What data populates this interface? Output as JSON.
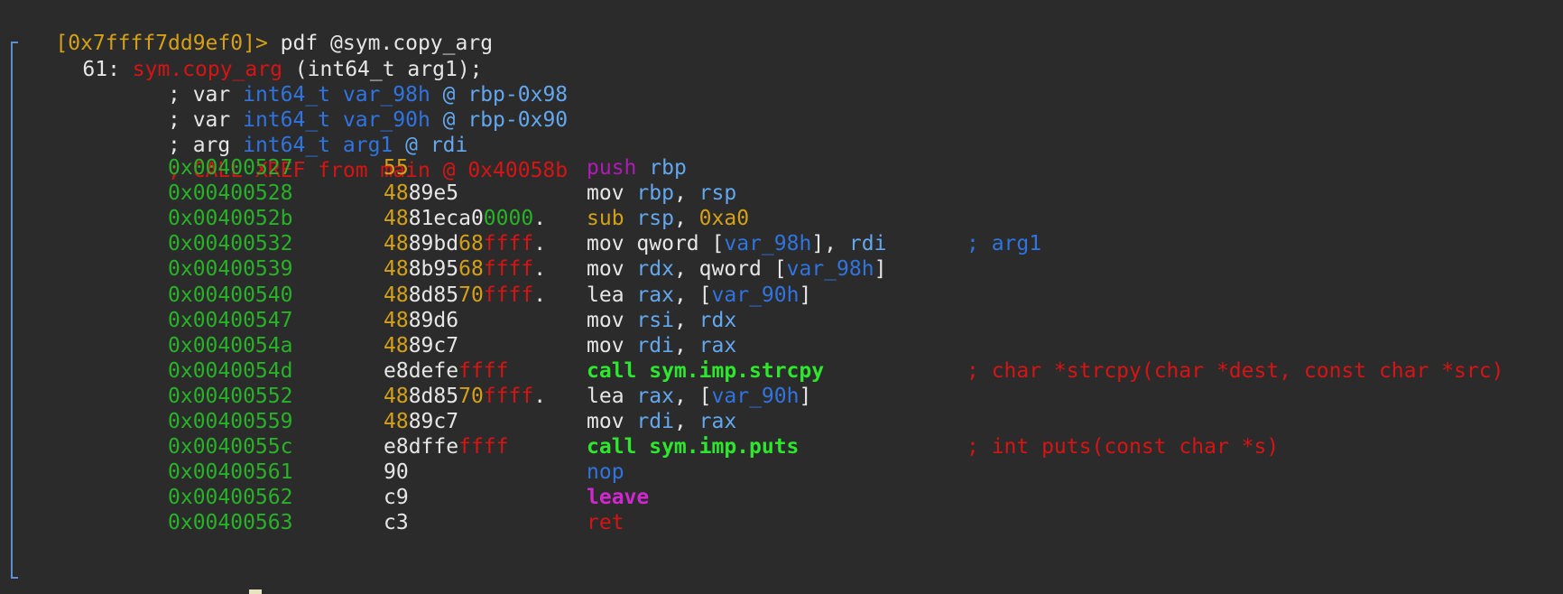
{
  "colors": {
    "background": "#2b2b2b",
    "default_text": "#e6e6e6",
    "prompt": "#d4a017",
    "address": "#27b227",
    "symbol_red": "#d71414",
    "type_blue": "#2f74e0",
    "register_blue": "#63a8ef",
    "byte_yellow": "#d4a017",
    "push_magenta": "#b21ab8",
    "call_green": "#2ee62e",
    "leave_magenta": "#d028d0",
    "nop_blue": "#2f74e0",
    "gutter_line": "#5a8fd0"
  },
  "prompt": {
    "address": "[0x7ffff7dd9ef0]>",
    "command": " pdf @sym.copy_arg"
  },
  "function_header": {
    "size_prefix": "61: ",
    "name": "sym.copy_arg",
    "signature": " (int64_t arg1);"
  },
  "vars": [
    {
      "prefix": "; var ",
      "type": "int64_t",
      "name": " var_98h",
      "at": " @ ",
      "loc": "rbp-0x98"
    },
    {
      "prefix": "; var ",
      "type": "int64_t",
      "name": " var_90h",
      "at": " @ ",
      "loc": "rbp-0x90"
    },
    {
      "prefix": "; arg ",
      "type": "int64_t",
      "name": " arg1",
      "at": " @ ",
      "loc": "rdi"
    }
  ],
  "xref_comment": "; CALL XREF from main @ 0x40058b",
  "instructions": [
    {
      "addr": "0x00400527",
      "bytes": "55",
      "mnemonic": "push",
      "operands": " rbp",
      "comment": ""
    },
    {
      "addr": "0x00400528",
      "bytes": "4889e5",
      "mnemonic": "mov",
      "operands": " rbp, rsp",
      "comment": ""
    },
    {
      "addr": "0x0040052b",
      "bytes": "4881eca00000.",
      "mnemonic": "sub",
      "operands": " rsp, 0xa0",
      "comment": ""
    },
    {
      "addr": "0x00400532",
      "bytes": "4889bd68ffff.",
      "mnemonic": "mov",
      "operands": " qword [var_98h], rdi",
      "comment": "; arg1"
    },
    {
      "addr": "0x00400539",
      "bytes": "488b9568ffff.",
      "mnemonic": "mov",
      "operands": " rdx, qword [var_98h]",
      "comment": ""
    },
    {
      "addr": "0x00400540",
      "bytes": "488d8570ffff.",
      "mnemonic": "lea",
      "operands": " rax, [var_90h]",
      "comment": ""
    },
    {
      "addr": "0x00400547",
      "bytes": "4889d6",
      "mnemonic": "mov",
      "operands": " rsi, rdx",
      "comment": ""
    },
    {
      "addr": "0x0040054a",
      "bytes": "4889c7",
      "mnemonic": "mov",
      "operands": " rdi, rax",
      "comment": ""
    },
    {
      "addr": "0x0040054d",
      "bytes": "e8defeffff",
      "mnemonic": "call",
      "operands": " sym.imp.strcpy",
      "comment": "; char *strcpy(char *dest, const char *src)"
    },
    {
      "addr": "0x00400552",
      "bytes": "488d8570ffff.",
      "mnemonic": "lea",
      "operands": " rax, [var_90h]",
      "comment": ""
    },
    {
      "addr": "0x00400559",
      "bytes": "4889c7",
      "mnemonic": "mov",
      "operands": " rdi, rax",
      "comment": ""
    },
    {
      "addr": "0x0040055c",
      "bytes": "e8dffeffff",
      "mnemonic": "call",
      "operands": " sym.imp.puts",
      "comment": "; int puts(const char *s)"
    },
    {
      "addr": "0x00400561",
      "bytes": "90",
      "mnemonic": "nop",
      "operands": "",
      "comment": ""
    },
    {
      "addr": "0x00400562",
      "bytes": "c9",
      "mnemonic": "leave",
      "operands": "",
      "comment": ""
    },
    {
      "addr": "0x00400563",
      "bytes": "c3",
      "mnemonic": "ret",
      "operands": "",
      "comment": ""
    }
  ]
}
